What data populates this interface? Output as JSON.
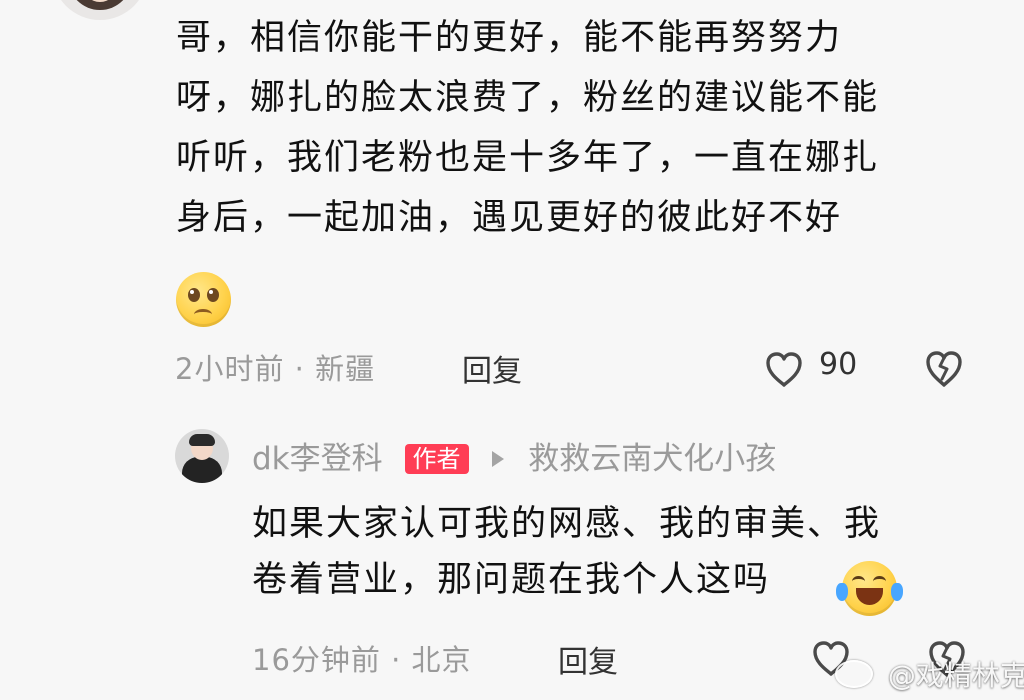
{
  "main_comment": {
    "avatar": "avatar",
    "lines": [
      "哥，相信你能干的更好，能不能再努努力",
      "呀，娜扎的脸太浪费了，粉丝的建议能不能",
      "听听，我们老粉也是十多年了，一直在娜扎",
      "身后，一起加油，遇见更好的彼此好不好"
    ],
    "emoji": "pleading-face",
    "time_location": "2小时前 · 新疆",
    "reply_label": "回复",
    "like_count": "90",
    "like_icon": "heart-outline-icon",
    "dislike_icon": "broken-heart-icon"
  },
  "reply_comment": {
    "avatar": "avatar",
    "author": "dk李登科",
    "badge": "作者",
    "reply_target_icon": "arrow-right-icon",
    "reply_target": "救救云南犬化小孩",
    "lines": [
      "如果大家认可我的网感、我的审美、我",
      "卷着营业，那问题在我个人这吗"
    ],
    "emoji": "laughing-crying-face",
    "time_location": "16分钟前 · 北京",
    "reply_label": "回复",
    "like_icon": "heart-outline-icon",
    "dislike_icon": "broken-heart-icon"
  },
  "watermark": {
    "icon": "weibo-logo",
    "text": "@戏精林克"
  },
  "colors": {
    "background": "#f7f7f7",
    "text": "#111111",
    "meta": "#9a9a9a",
    "author_badge": "#ff3d55"
  }
}
